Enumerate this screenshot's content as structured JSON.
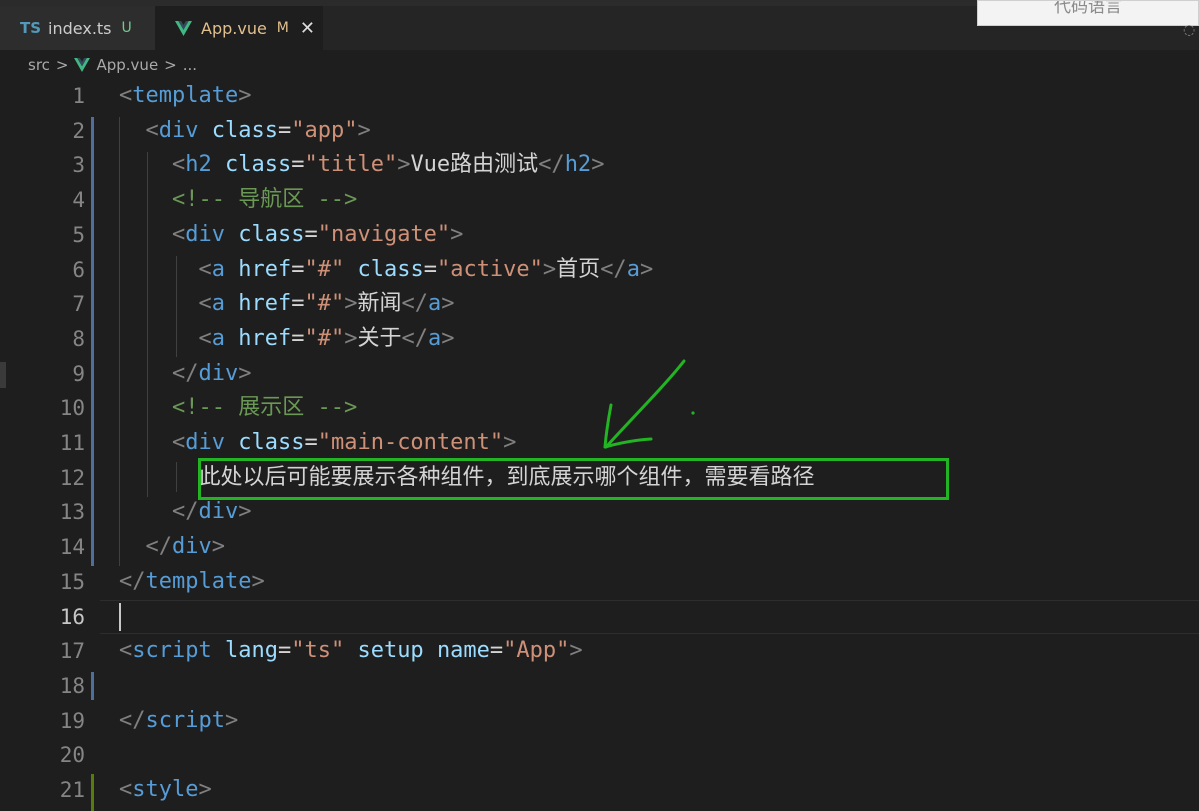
{
  "tabs": [
    {
      "icon": "TS",
      "name": "index.ts",
      "badge": "U",
      "active": false
    },
    {
      "icon": "vue-icon",
      "name": "App.vue",
      "badge": "M",
      "close": "✕",
      "active": true
    }
  ],
  "popup": {
    "label": "代码语言"
  },
  "breadcrumb": {
    "folder": "src",
    "file": "App.vue",
    "more": "..."
  },
  "colors": {
    "annotation": "#22b422",
    "tag": "#569cd6",
    "attr": "#9cdcfe",
    "string": "#ce9178",
    "comment": "#6a9955"
  },
  "annotation": {
    "box_text_line": 12,
    "arrow_color": "#22b422"
  },
  "current_line": 16,
  "code_lines": [
    {
      "n": "1",
      "tokens": [
        [
          "br",
          "<"
        ],
        [
          "tag",
          "template"
        ],
        [
          "br",
          ">"
        ]
      ]
    },
    {
      "n": "2",
      "tokens": [
        [
          "txt",
          "  "
        ],
        [
          "br",
          "<"
        ],
        [
          "tag",
          "div"
        ],
        [
          "txt",
          " "
        ],
        [
          "attr",
          "class"
        ],
        [
          "eq",
          "="
        ],
        [
          "str",
          "\"app\""
        ],
        [
          "br",
          ">"
        ]
      ]
    },
    {
      "n": "3",
      "tokens": [
        [
          "txt",
          "    "
        ],
        [
          "br",
          "<"
        ],
        [
          "tag",
          "h2"
        ],
        [
          "txt",
          " "
        ],
        [
          "attr",
          "class"
        ],
        [
          "eq",
          "="
        ],
        [
          "str",
          "\"title\""
        ],
        [
          "br",
          ">"
        ],
        [
          "txt",
          "Vue路由测试"
        ],
        [
          "br",
          "</"
        ],
        [
          "tag",
          "h2"
        ],
        [
          "br",
          ">"
        ]
      ]
    },
    {
      "n": "4",
      "tokens": [
        [
          "txt",
          "    "
        ],
        [
          "com",
          "<!-- 导航区 -->"
        ]
      ]
    },
    {
      "n": "5",
      "tokens": [
        [
          "txt",
          "    "
        ],
        [
          "br",
          "<"
        ],
        [
          "tag",
          "div"
        ],
        [
          "txt",
          " "
        ],
        [
          "attr",
          "class"
        ],
        [
          "eq",
          "="
        ],
        [
          "str",
          "\"navigate\""
        ],
        [
          "br",
          ">"
        ]
      ]
    },
    {
      "n": "6",
      "tokens": [
        [
          "txt",
          "      "
        ],
        [
          "br",
          "<"
        ],
        [
          "tag",
          "a"
        ],
        [
          "txt",
          " "
        ],
        [
          "attr",
          "href"
        ],
        [
          "eq",
          "="
        ],
        [
          "str",
          "\"#\""
        ],
        [
          "txt",
          " "
        ],
        [
          "attr",
          "class"
        ],
        [
          "eq",
          "="
        ],
        [
          "str",
          "\"active\""
        ],
        [
          "br",
          ">"
        ],
        [
          "txt",
          "首页"
        ],
        [
          "br",
          "</"
        ],
        [
          "tag",
          "a"
        ],
        [
          "br",
          ">"
        ]
      ]
    },
    {
      "n": "7",
      "tokens": [
        [
          "txt",
          "      "
        ],
        [
          "br",
          "<"
        ],
        [
          "tag",
          "a"
        ],
        [
          "txt",
          " "
        ],
        [
          "attr",
          "href"
        ],
        [
          "eq",
          "="
        ],
        [
          "str",
          "\"#\""
        ],
        [
          "br",
          ">"
        ],
        [
          "txt",
          "新闻"
        ],
        [
          "br",
          "</"
        ],
        [
          "tag",
          "a"
        ],
        [
          "br",
          ">"
        ]
      ]
    },
    {
      "n": "8",
      "tokens": [
        [
          "txt",
          "      "
        ],
        [
          "br",
          "<"
        ],
        [
          "tag",
          "a"
        ],
        [
          "txt",
          " "
        ],
        [
          "attr",
          "href"
        ],
        [
          "eq",
          "="
        ],
        [
          "str",
          "\"#\""
        ],
        [
          "br",
          ">"
        ],
        [
          "txt",
          "关于"
        ],
        [
          "br",
          "</"
        ],
        [
          "tag",
          "a"
        ],
        [
          "br",
          ">"
        ]
      ]
    },
    {
      "n": "9",
      "tokens": [
        [
          "txt",
          "    "
        ],
        [
          "br",
          "</"
        ],
        [
          "tag",
          "div"
        ],
        [
          "br",
          ">"
        ]
      ]
    },
    {
      "n": "10",
      "tokens": [
        [
          "txt",
          "    "
        ],
        [
          "com",
          "<!-- 展示区 -->"
        ]
      ]
    },
    {
      "n": "11",
      "tokens": [
        [
          "txt",
          "    "
        ],
        [
          "br",
          "<"
        ],
        [
          "tag",
          "div"
        ],
        [
          "txt",
          " "
        ],
        [
          "attr",
          "class"
        ],
        [
          "eq",
          "="
        ],
        [
          "str",
          "\"main-content\""
        ],
        [
          "br",
          ">"
        ]
      ]
    },
    {
      "n": "12",
      "tokens": [
        [
          "txt",
          "      "
        ],
        [
          "txt",
          "此处以后可能要展示各种组件，到底展示哪个组件，需要看路径"
        ]
      ]
    },
    {
      "n": "13",
      "tokens": [
        [
          "txt",
          "    "
        ],
        [
          "br",
          "</"
        ],
        [
          "tag",
          "div"
        ],
        [
          "br",
          ">"
        ]
      ]
    },
    {
      "n": "14",
      "tokens": [
        [
          "txt",
          "  "
        ],
        [
          "br",
          "</"
        ],
        [
          "tag",
          "div"
        ],
        [
          "br",
          ">"
        ]
      ]
    },
    {
      "n": "15",
      "tokens": [
        [
          "br",
          "</"
        ],
        [
          "tag",
          "template"
        ],
        [
          "br",
          ">"
        ]
      ]
    },
    {
      "n": "16",
      "tokens": []
    },
    {
      "n": "17",
      "tokens": [
        [
          "br",
          "<"
        ],
        [
          "tag",
          "script"
        ],
        [
          "txt",
          " "
        ],
        [
          "attr",
          "lang"
        ],
        [
          "eq",
          "="
        ],
        [
          "str",
          "\"ts\""
        ],
        [
          "txt",
          " "
        ],
        [
          "attr",
          "setup"
        ],
        [
          "txt",
          " "
        ],
        [
          "attr",
          "name"
        ],
        [
          "eq",
          "="
        ],
        [
          "str",
          "\"App\""
        ],
        [
          "br",
          ">"
        ]
      ]
    },
    {
      "n": "18",
      "tokens": []
    },
    {
      "n": "19",
      "tokens": [
        [
          "br",
          "</"
        ],
        [
          "tag",
          "script"
        ],
        [
          "br",
          ">"
        ]
      ]
    },
    {
      "n": "20",
      "tokens": []
    },
    {
      "n": "21",
      "tokens": [
        [
          "br",
          "<"
        ],
        [
          "tag",
          "style"
        ],
        [
          "br",
          ">"
        ]
      ]
    }
  ]
}
